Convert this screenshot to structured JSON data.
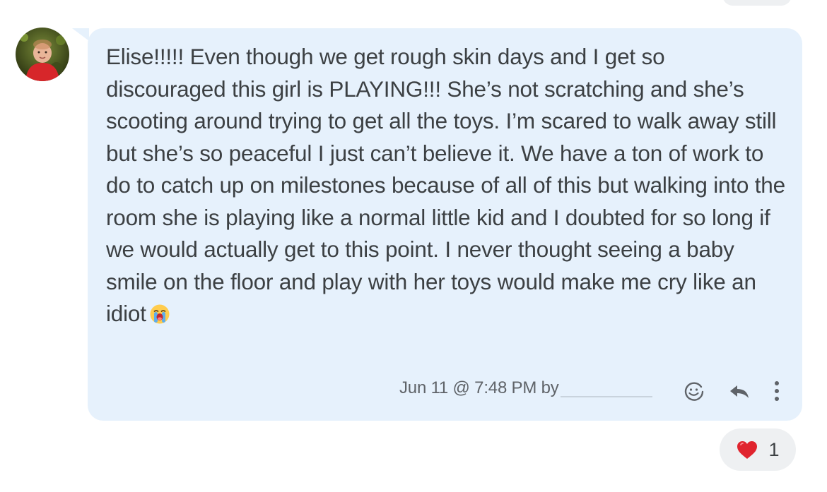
{
  "message": {
    "author_avatar": "avatar",
    "text": "Elise!!!!! Even though we get rough skin days and I get so discouraged this girl is PLAYING!!! She’s not scratching and she’s scooting around trying to get all the toys. I’m scared to walk away still but she’s so peaceful I just can’t believe it. We have a ton of work to do to catch up on milestones because of all of this but walking into the room she is playing like a normal little kid and I doubted for so long if we would actually get to this point. I never thought seeing a baby smile on the floor and play with her toys would make me cry like an idiot",
    "emoji": "loudly-crying-face",
    "timestamp": "Jun 11 @ 7:48 PM by",
    "actions": [
      "add-reaction-icon",
      "reply-icon",
      "more-vertical-icon"
    ]
  },
  "reaction": {
    "icon": "heart-icon",
    "count": "1",
    "color": "#e0242e"
  },
  "colors": {
    "bubble": "#e6f1fc",
    "text": "#3c4043",
    "meta": "#5f6368"
  }
}
